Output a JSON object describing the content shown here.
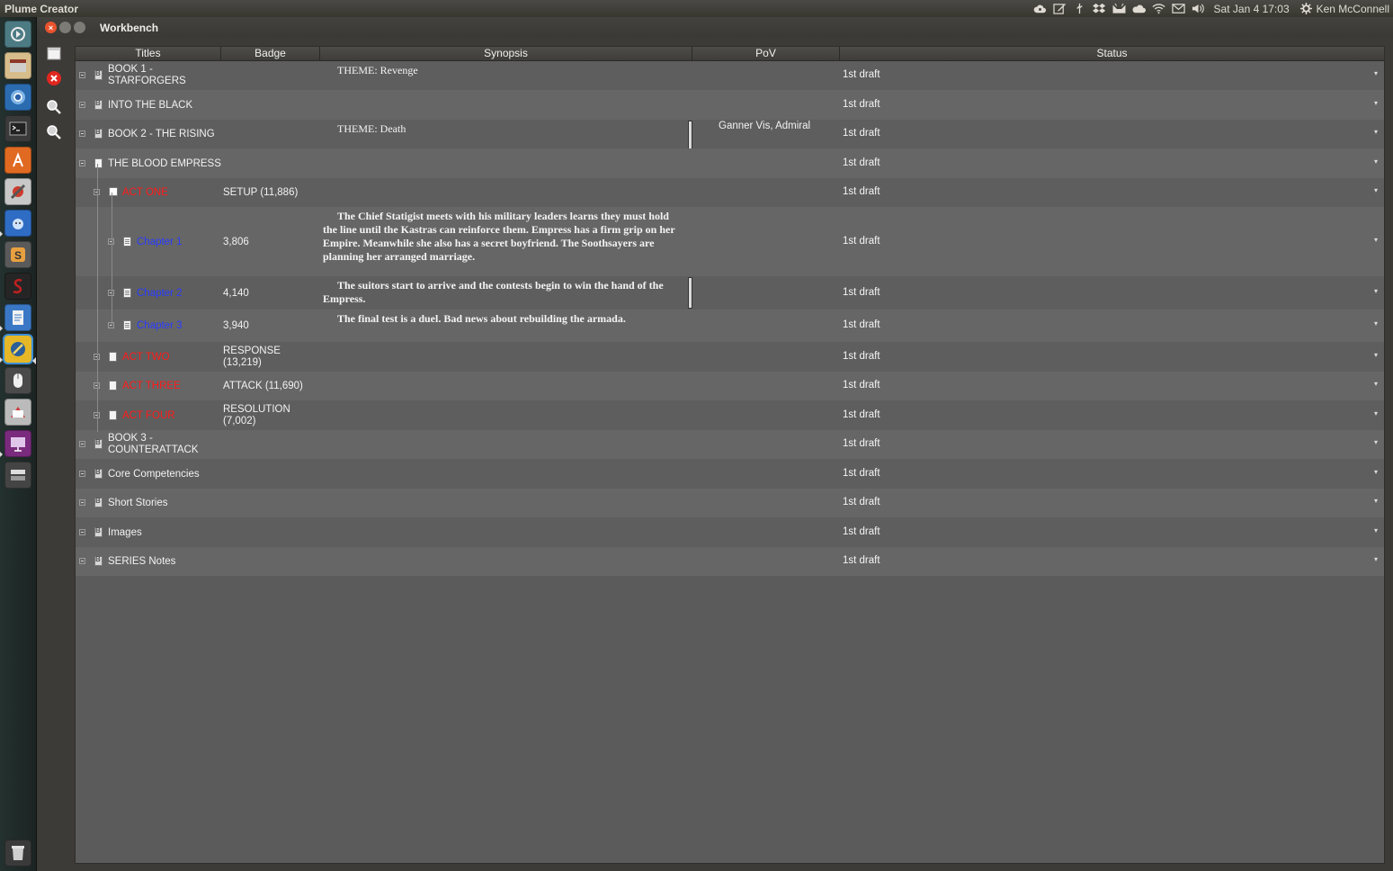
{
  "app": {
    "name": "Plume Creator"
  },
  "panel": {
    "clock": "Sat Jan 4 17:03",
    "user": "Ken McConnell",
    "indicators": [
      "cloud-icon",
      "edit-icon",
      "usb-icon",
      "dropbox-icon",
      "tray-icon",
      "weather-icon",
      "wifi-icon",
      "mail-icon",
      "volume-icon"
    ]
  },
  "window": {
    "title": "Workbench",
    "close": "×"
  },
  "launcher": [
    "dash-icon",
    "files-icon",
    "chromium-icon",
    "terminal-icon",
    "software-center-icon",
    "settings-icon",
    "app-icon",
    "sublime-icon",
    "scrivener-icon",
    "writer-icon",
    "plume-icon",
    "mouse-icon",
    "reader-icon",
    "presentation-icon",
    "disks-icon",
    "trash-icon"
  ],
  "toolbar": [
    "new-doc-icon",
    "close-doc-icon",
    "zoom-in-icon",
    "zoom-out-icon"
  ],
  "tree": {
    "headers": {
      "titles": "Titles",
      "badge": "Badge",
      "synopsis": "Synopsis",
      "pov": "PoV",
      "status": "Status"
    },
    "rows": [
      {
        "title": "BOOK 1 - STARFORGERS",
        "badge": "",
        "synopsis": "THEME: Revenge",
        "pov": "",
        "status": "1st draft",
        "title_color": "white"
      },
      {
        "title": "INTO THE BLACK",
        "badge": "",
        "synopsis": "",
        "pov": "",
        "status": "1st draft",
        "title_color": "white"
      },
      {
        "title": "BOOK 2 - THE RISING",
        "badge": "",
        "synopsis": "THEME: Death",
        "pov": "Ganner Vis, Admiral",
        "status": "1st draft",
        "title_color": "white"
      },
      {
        "title": "THE BLOOD EMPRESS",
        "badge": "",
        "synopsis": "",
        "pov": "",
        "status": "1st draft",
        "title_color": "white"
      },
      {
        "title": "ACT ONE",
        "badge": "SETUP (11,886)",
        "synopsis": "",
        "pov": "",
        "status": "1st draft",
        "title_color": "#ff1a1a"
      },
      {
        "title": "Chapter 1",
        "badge": "3,806",
        "synopsis": "The Chief Statigist meets with his military leaders learns they must hold the line until the Kastras can reinforce them. Empress has a firm grip on her Empire. Meanwhile she also has a secret boyfriend. The Soothsayers are planning her arranged marriage.",
        "pov": "",
        "status": "1st draft",
        "title_color": "#2a3cff"
      },
      {
        "title": "Chapter 2",
        "badge": "4,140",
        "synopsis": "The suitors start to arrive and the contests begin to win the hand of the Empress.",
        "pov": "",
        "status": "1st draft",
        "title_color": "#2a3cff"
      },
      {
        "title": "Chapter 3",
        "badge": "3,940",
        "synopsis": "The final test is a duel. Bad news about rebuilding the armada.",
        "pov": "",
        "status": "1st draft",
        "title_color": "#2a3cff"
      },
      {
        "title": "ACT TWO",
        "badge": "RESPONSE (13,219)",
        "synopsis": "",
        "pov": "",
        "status": "1st draft",
        "title_color": "#ff1a1a"
      },
      {
        "title": "ACT THREE",
        "badge": "ATTACK (11,690)",
        "synopsis": "",
        "pov": "",
        "status": "1st draft",
        "title_color": "#ff1a1a"
      },
      {
        "title": "ACT FOUR",
        "badge": "RESOLUTION (7,002)",
        "synopsis": "",
        "pov": "",
        "status": "1st draft",
        "title_color": "#ff1a1a"
      },
      {
        "title": "BOOK 3 - COUNTERATTACK",
        "badge": "",
        "synopsis": "",
        "pov": "",
        "status": "1st draft",
        "title_color": "white"
      },
      {
        "title": "Core Competencies",
        "badge": "",
        "synopsis": "",
        "pov": "",
        "status": "1st draft",
        "title_color": "white"
      },
      {
        "title": "Short Stories",
        "badge": "",
        "synopsis": "",
        "pov": "",
        "status": "1st draft",
        "title_color": "white"
      },
      {
        "title": "Images",
        "badge": "",
        "synopsis": "",
        "pov": "",
        "status": "1st draft",
        "title_color": "white"
      },
      {
        "title": "SERIES Notes",
        "badge": "",
        "synopsis": "",
        "pov": "",
        "status": "1st draft",
        "title_color": "white"
      }
    ]
  }
}
